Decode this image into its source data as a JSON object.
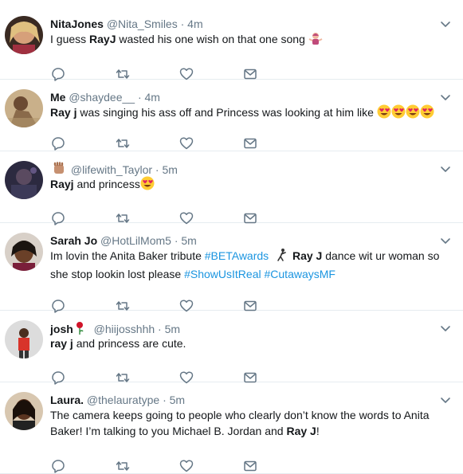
{
  "tweets": [
    {
      "name": "NitaJones",
      "handle": "@Nita_Smiles",
      "time": "4m",
      "segments": [
        {
          "t": "I guess "
        },
        {
          "t": "RayJ",
          "b": true
        },
        {
          "t": " wasted his one wish on that one song "
        }
      ],
      "emojis": [
        "woman-shrugging"
      ]
    },
    {
      "name": "Me",
      "handle": "@shaydee__",
      "time": "4m",
      "segments": [
        {
          "t": "Ray j",
          "b": true
        },
        {
          "t": " was singing his ass off and Princess was looking at him like "
        }
      ],
      "emojis": [
        "heart-eyes",
        "heart-eyes",
        "heart-eyes",
        "heart-eyes"
      ]
    },
    {
      "name": "",
      "name_emoji": "raised-fist",
      "handle": "@lifewith_Taylor",
      "time": "5m",
      "segments": [
        {
          "t": "Rayj",
          "b": true
        },
        {
          "t": " and princess"
        }
      ],
      "emojis": [
        "heart-eyes"
      ]
    },
    {
      "name": "Sarah Jo",
      "handle": "@HotLilMom5",
      "time": "5m",
      "segments": [
        {
          "t": "Im lovin the Anita Baker tribute "
        },
        {
          "t": "#BETAwards",
          "tag": true
        },
        {
          "t": " 🕺 ",
          "glyph": "dancing-man"
        },
        {
          "t": "Ray J",
          "b": true
        },
        {
          "t": " dance wit ur woman so she stop lookin lost please "
        },
        {
          "t": "#ShowUsItReal",
          "tag": true
        },
        {
          "t": " "
        },
        {
          "t": "#CutawaysMF",
          "tag": true
        }
      ],
      "emojis": []
    },
    {
      "name": "josh",
      "name_emoji": "rose",
      "handle": "@hiijosshhh",
      "time": "5m",
      "segments": [
        {
          "t": "ray j",
          "b": true
        },
        {
          "t": " and princess are cute."
        }
      ],
      "emojis": []
    },
    {
      "name": "Laura.",
      "handle": "@thelauratype",
      "time": "5m",
      "segments": [
        {
          "t": "The camera keeps going to people who clearly don’t know the words to Anita Baker! I’m talking to you Michael B. Jordan and "
        },
        {
          "t": "Ray J",
          "b": true
        },
        {
          "t": "!"
        }
      ],
      "emojis": []
    }
  ],
  "icons": [
    "reply-icon",
    "retweet-icon",
    "like-icon",
    "direct-message-icon",
    "chevron-down-icon"
  ],
  "colors": {
    "text": "#14171a",
    "muted": "#657786",
    "link": "#1b95e0",
    "divider": "#e6ecf0"
  }
}
